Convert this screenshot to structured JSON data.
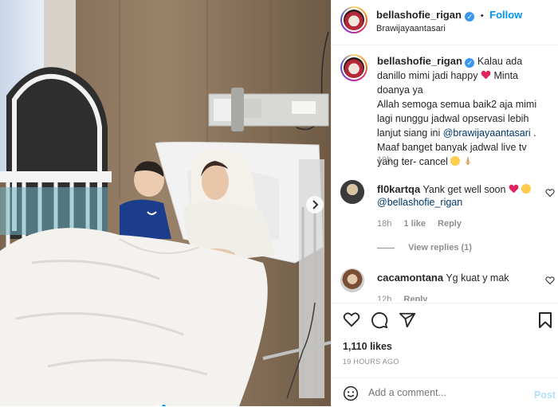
{
  "post": {
    "username": "bellashofie_rigan",
    "location": "Brawijayaantasari",
    "follow_label": "Follow",
    "follow_dot": "•",
    "caption_lines": [
      "Kalau ada danillo",
      "mimi jadi happy",
      "Minta doanya ya",
      "Allah semoga semua baik2 aja mimi",
      "lagi nunggu jadwal opservasi lebih",
      "lanjut siang ini",
      "@brawijayaantasari",
      ".",
      "Maaf banget banyak jadwal live tv",
      "yang ter- cancel"
    ],
    "caption_time": "19h",
    "likes": "1,110 likes",
    "posted": "19 HOURS AGO"
  },
  "comments": [
    {
      "username": "fl0kartqa",
      "text": "Yank get well soon",
      "mention": "@bellashofie_rigan",
      "time": "18h",
      "likes": "1 like",
      "reply": "Reply",
      "view_replies": "View replies (1)"
    },
    {
      "username": "cacamontana",
      "text": "Yg kuat y mak",
      "time": "12h",
      "reply": "Reply"
    }
  ],
  "composer": {
    "placeholder": "Add a comment...",
    "post_label": "Post"
  },
  "icons": {
    "verified": "verified-badge",
    "heart": "heart-icon",
    "comment": "comment-icon",
    "share": "share-icon",
    "save": "bookmark-icon",
    "emoji": "smiley-icon",
    "next": "chevron-right-icon"
  },
  "colors": {
    "link": "#00376b",
    "accent": "#0095f6",
    "heart_red": "#ed4956"
  },
  "carousel": {
    "count": 2,
    "active": 2
  }
}
